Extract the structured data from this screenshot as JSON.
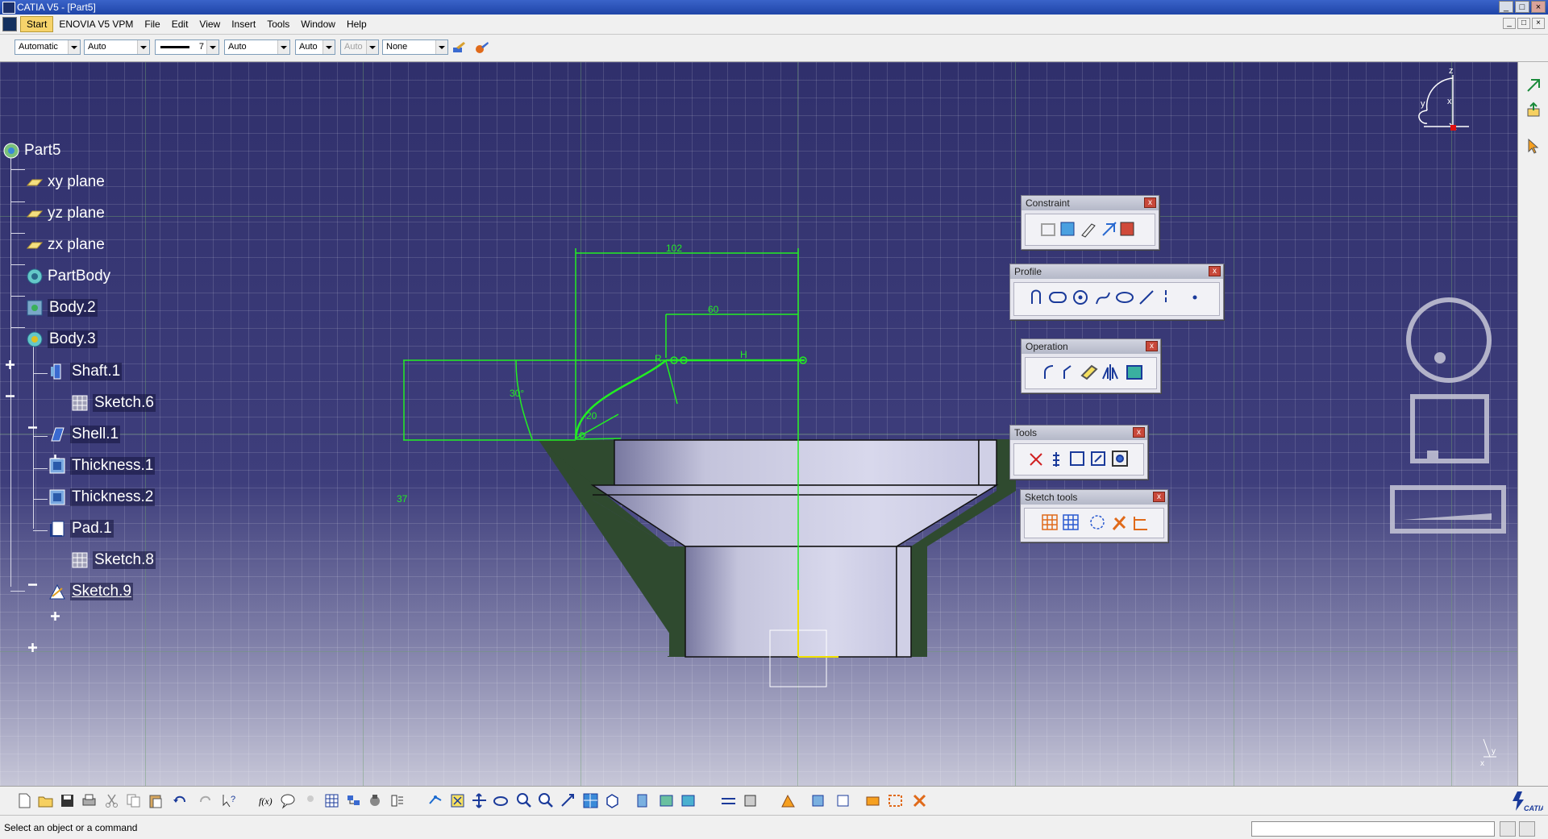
{
  "window": {
    "title": "CATIA V5 - [Part5]",
    "controls": [
      "_",
      "□",
      "×"
    ]
  },
  "menubar": {
    "items": [
      "Start",
      "ENOVIA V5 VPM",
      "File",
      "Edit",
      "View",
      "Insert",
      "Tools",
      "Window",
      "Help"
    ],
    "active": "Start",
    "doc_controls": [
      "_",
      "□",
      "×"
    ]
  },
  "properties_toolbar": {
    "color": "Automatic",
    "transparency": "Auto",
    "line_weight": "7",
    "line_type": "Auto",
    "point_symbol": "Auto",
    "layer_disabled": "Auto",
    "layer": "None"
  },
  "tree": {
    "root": "Part5",
    "items": [
      {
        "label": "xy plane",
        "icon": "plane-icon"
      },
      {
        "label": "yz plane",
        "icon": "plane-icon"
      },
      {
        "label": "zx plane",
        "icon": "plane-icon"
      },
      {
        "label": "PartBody",
        "icon": "body-icon"
      },
      {
        "label": "Body.2",
        "icon": "body-icon"
      },
      {
        "label": "Body.3",
        "icon": "body-icon"
      },
      {
        "label": "Shaft.1",
        "icon": "shaft-icon"
      },
      {
        "label": "Sketch.6",
        "icon": "sketch-icon"
      },
      {
        "label": "Shell.1",
        "icon": "shell-icon"
      },
      {
        "label": "Thickness.1",
        "icon": "thickness-icon"
      },
      {
        "label": "Thickness.2",
        "icon": "thickness-icon"
      },
      {
        "label": "Pad.1",
        "icon": "pad-icon"
      },
      {
        "label": "Sketch.8",
        "icon": "sketch-icon"
      },
      {
        "label": "Sketch.9",
        "icon": "sketch-icon"
      }
    ]
  },
  "sketch": {
    "dimensions": {
      "width_total": "102",
      "width_top": "60",
      "angle": "30°",
      "radius": "20",
      "height": "37"
    },
    "constraint_letters": {
      "h": "H",
      "r": "R"
    }
  },
  "compass": {
    "x_axis": "x",
    "y_axis": "y",
    "z_axis": "z"
  },
  "panels": {
    "constraint": {
      "title": "Constraint",
      "close": "x"
    },
    "profile": {
      "title": "Profile",
      "close": "x"
    },
    "operation": {
      "title": "Operation",
      "close": "x"
    },
    "tools": {
      "title": "Tools",
      "close": "x"
    },
    "sketch_tools": {
      "title": "Sketch tools",
      "close": "x"
    }
  },
  "axis_corner": {
    "x": "x",
    "y": "y"
  },
  "status": {
    "message": "Select an object or a command"
  },
  "brand": {
    "text": "CATIA"
  },
  "colors": {
    "sketch_green": "#22ee22",
    "background_top": "#30306c",
    "background_bottom": "#c7c7d8",
    "part_face": "#c8c8e0",
    "part_section": "#2f4a2f",
    "highlight_yellow": "#f6d36b"
  }
}
